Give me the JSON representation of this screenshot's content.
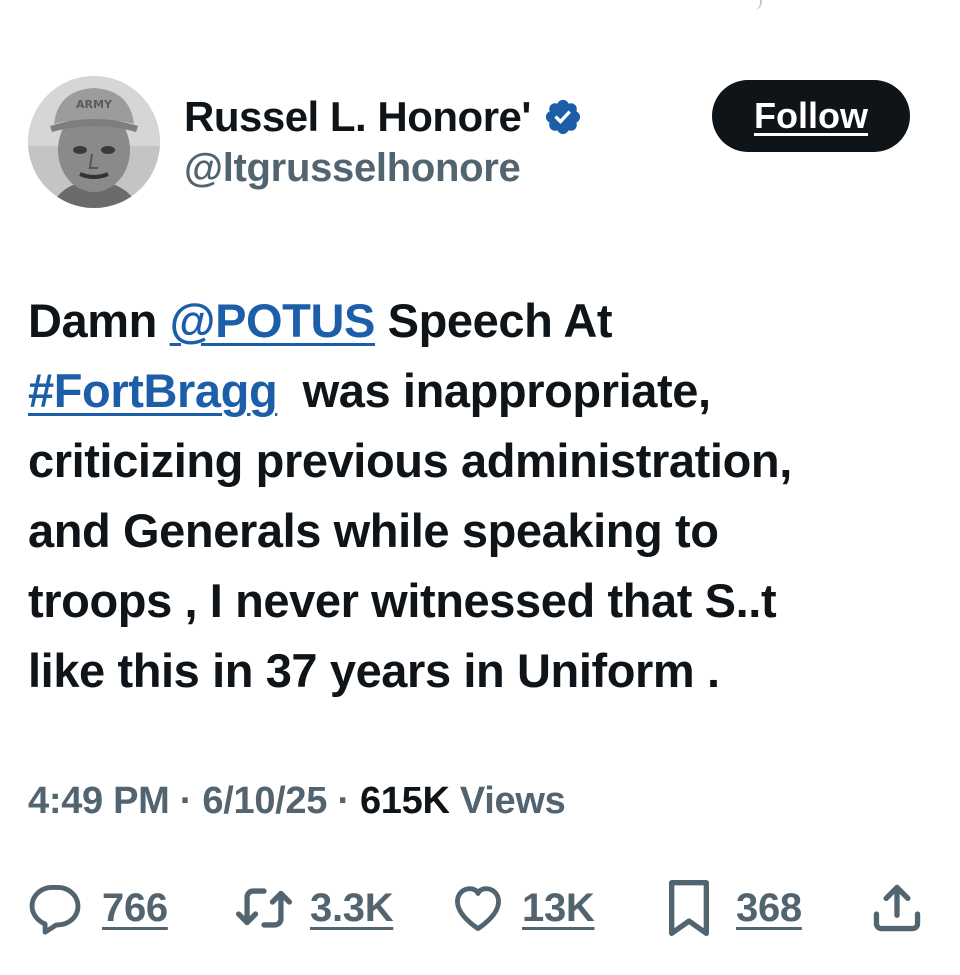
{
  "author": {
    "display_name": "Russel L. Honore'",
    "handle": "@ltgrusselhonore",
    "avatar_cap_text": "ARMY"
  },
  "follow_button": {
    "label": "Follow"
  },
  "tweet": {
    "text_before": "Damn ",
    "mention": "@POTUS",
    "text_middle": " Speech At\n",
    "hashtag": "#FortBragg",
    "text_after": "  was inappropriate,\ncriticizing previous administration,\nand Generals while speaking to\ntroops , I never witnessed that S..t\nlike this in 37 years in Uniform ."
  },
  "meta": {
    "time": "4:49 PM",
    "separator": " · ",
    "date": "6/10/25",
    "views_count": "615K",
    "views_label": " Views"
  },
  "actions": {
    "replies": "766",
    "reposts": "3.3K",
    "likes": "13K",
    "bookmarks": "368"
  },
  "colors": {
    "text": "#0f1419",
    "secondary": "#536471",
    "link": "#1d5ea8",
    "verified": "#1d5ea8",
    "button_bg": "#0f1419"
  },
  "icons": {
    "verified": "verified-badge-icon",
    "reply": "reply-icon",
    "repost": "repost-icon",
    "like": "heart-icon",
    "bookmark": "bookmark-icon",
    "share": "share-icon"
  }
}
